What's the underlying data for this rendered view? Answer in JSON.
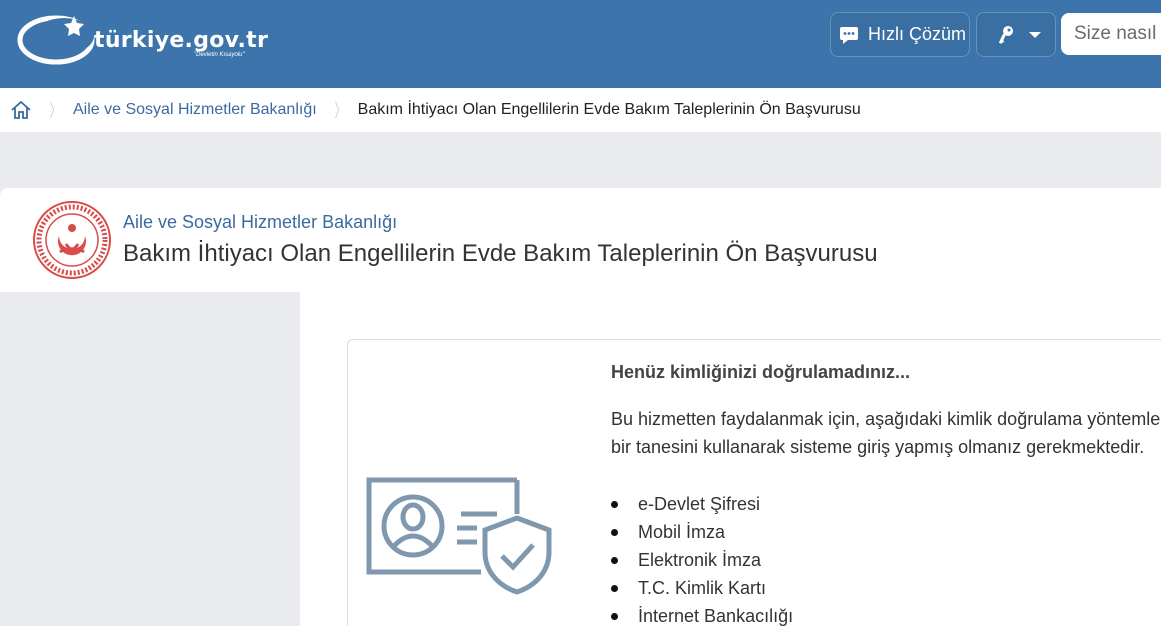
{
  "header": {
    "logo_text": "türkiye.gov.tr",
    "logo_tagline": "\"Devletin Kısayolu\"",
    "quick_solution_label": "Hızlı Çözüm",
    "search_placeholder": "Size nasıl yardımcı olabilirim?",
    "accent_color": "#3c74ab"
  },
  "breadcrumb": {
    "home_icon": "home-icon",
    "items": [
      {
        "label": "Aile ve Sosyal Hizmetler Bakanlığı"
      },
      {
        "label": "Bakım İhtiyacı Olan Engellilerin Evde Bakım Taleplerinin Ön Başvurusu"
      }
    ]
  },
  "service": {
    "organization": "Aile ve Sosyal Hizmetler Bakanlığı",
    "title": "Bakım İhtiyacı Olan Engellilerin Evde Bakım Taleplerinin Ön Başvurusu"
  },
  "auth_notice": {
    "title": "Henüz kimliğinizi doğrulamadınız...",
    "line1": "Bu hizmetten faydalanmak için, aşağıdaki kimlik doğrulama yöntemlerinden",
    "line2": "bir tanesini kullanarak sisteme giriş yapmış olmanız gerekmektedir.",
    "methods": [
      "e-Devlet Şifresi",
      "Mobil İmza",
      "Elektronik İmza",
      "T.C. Kimlik Kartı",
      "İnternet Bankacılığı"
    ]
  }
}
